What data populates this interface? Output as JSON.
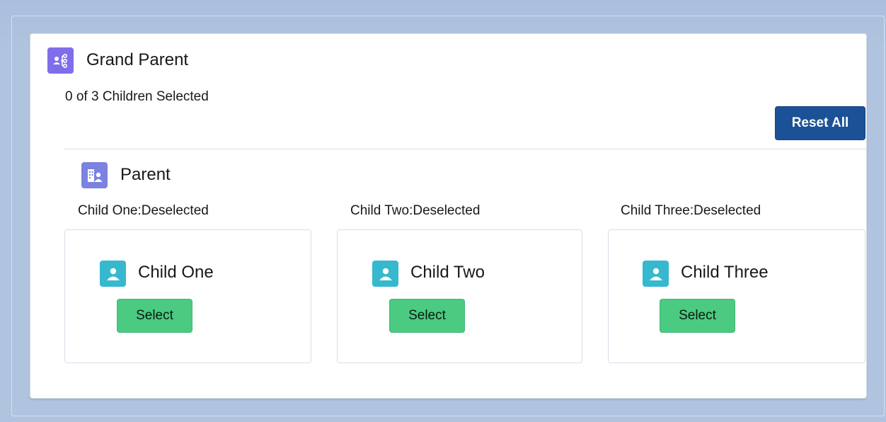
{
  "grand_parent": {
    "icon": "hierarchy-icon",
    "title": "Grand Parent",
    "summary": "0 of 3 Children Selected",
    "reset_label": "Reset All"
  },
  "parent": {
    "icon": "building-contact-icon",
    "title": "Parent"
  },
  "children": [
    {
      "status": "Child One:Deselected",
      "title": "Child One",
      "icon": "person-icon",
      "button_label": "Select"
    },
    {
      "status": "Child Two:Deselected",
      "title": "Child Two",
      "icon": "person-icon",
      "button_label": "Select"
    },
    {
      "status": "Child Three:Deselected",
      "title": "Child Three",
      "icon": "person-icon",
      "button_label": "Select"
    }
  ],
  "colors": {
    "grand_parent_icon": "#7f6eea",
    "parent_icon": "#7b82e0",
    "child_icon": "#36b8cf",
    "reset_button": "#1b5297",
    "select_button": "#4bca81",
    "background": "#b0c4df"
  }
}
